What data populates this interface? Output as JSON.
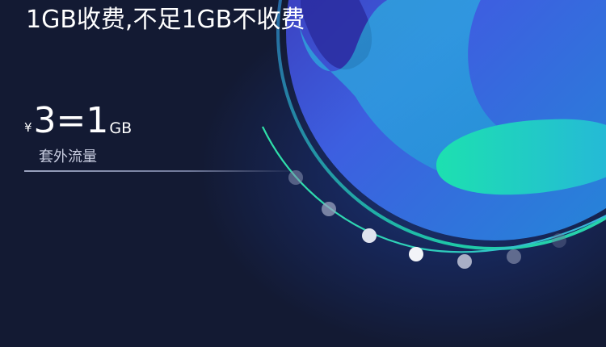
{
  "banner": {
    "headline": "1GB收费,不足1GB不收费",
    "price": {
      "currency": "¥",
      "value": "3=1",
      "unit": "GB"
    },
    "subtitle": "套外流量"
  },
  "colors": {
    "background": "#131a33",
    "accent_green": "#2fe0b0",
    "accent_blue": "#3c7cf0",
    "text": "#ffffff",
    "muted_text": "#c8cde0"
  }
}
